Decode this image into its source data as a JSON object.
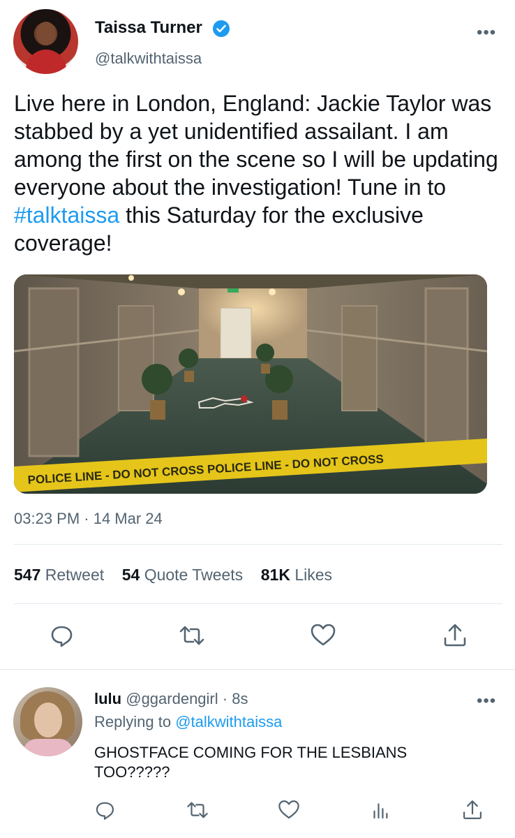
{
  "tweet": {
    "author_name": "Taissa Turner",
    "author_handle": "@talkwithtaissa",
    "more_label": "•••",
    "text_before": "Live here in London, England: Jackie Taylor was stabbed by a yet unidentified assailant. I am among the first on the scene so I will be updating everyone about the investigation! Tune in to ",
    "hashtag": "#talktaissa",
    "text_after": " this Saturday for the exclusive coverage!",
    "media_tape_text": "POLICE LINE - DO NOT CROSS   POLICE LINE - DO NOT CROSS",
    "timestamp": "03:23 PM · 14 Mar 24",
    "stats": {
      "retweets_count": "547",
      "retweets_label": "Retweet",
      "quotes_count": "54",
      "quotes_label": "Quote Tweets",
      "likes_count": "81K",
      "likes_label": "Likes"
    }
  },
  "reply": {
    "name": "lulu",
    "handle": "@ggardengirl",
    "time": "· 8s",
    "more_label": "•••",
    "replying_prefix": "Replying to",
    "replying_mention": "@talkwithtaissa",
    "text": "GHOSTFACE COMING FOR THE LESBIANS TOO?????"
  },
  "icons": {
    "reply": "reply-icon",
    "retweet": "retweet-icon",
    "like": "heart-icon",
    "share": "share-icon",
    "analytics": "analytics-icon",
    "verified": "verified-badge-icon"
  },
  "colors": {
    "accent": "#1d9bf0",
    "text": "#0f1419",
    "secondary": "#536471"
  }
}
